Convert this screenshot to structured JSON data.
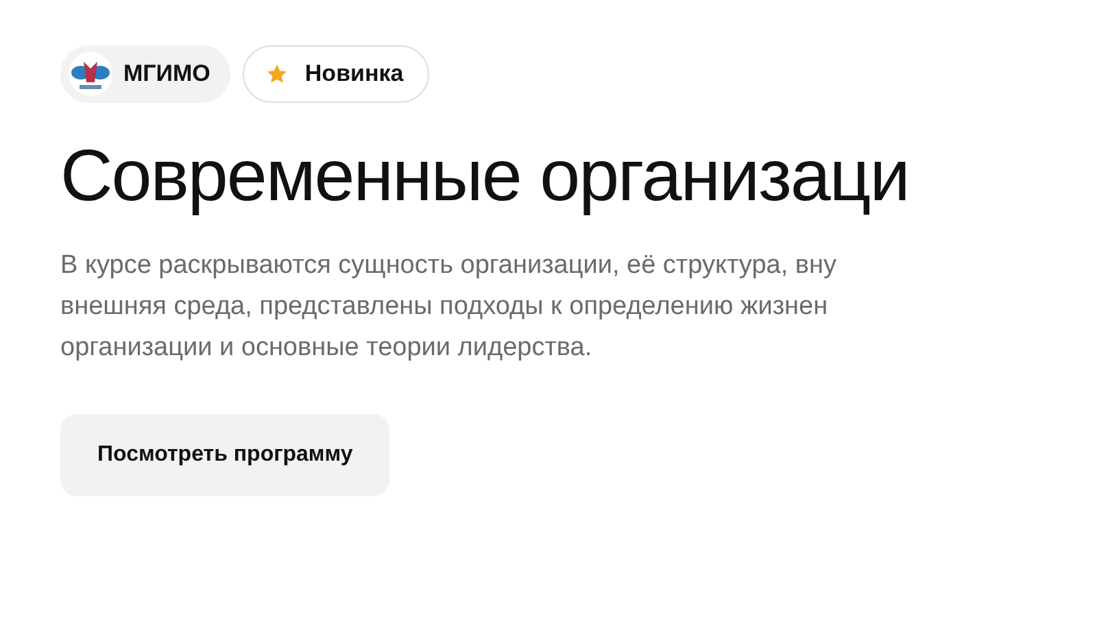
{
  "tags": [
    {
      "kind": "university",
      "label": "МГИМО"
    },
    {
      "kind": "new",
      "label": "Новинка"
    }
  ],
  "title": "Современные организаци",
  "description": [
    "В курсе раскрываются сущность организации, её структура, вну",
    "внешняя среда, представлены подходы к определению жизнен",
    "организации и основные теории лидерства."
  ],
  "button": "Посмотреть программу"
}
